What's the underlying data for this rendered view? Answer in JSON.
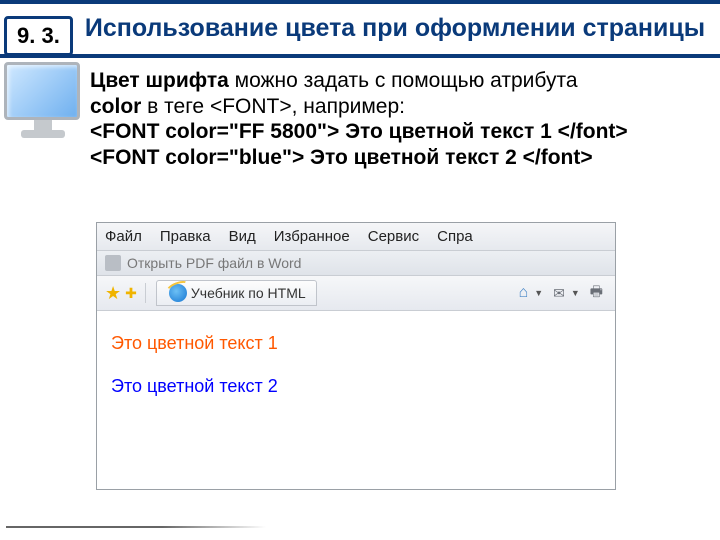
{
  "header": {
    "section_number": "9. 3.",
    "title": "Использование цвета при оформлении страницы"
  },
  "body": {
    "intro_part1": "Цвет шрифта",
    "intro_part2": " можно задать с помощью атрибута ",
    "intro_part3": "color",
    "intro_part4": " в теге <FONT>, например:",
    "code_line1": "<FONT color=\"FF 5800\"> Это цветной текст 1 </font>",
    "code_line2": "<FONT color=\"blue\"> Это цветной текст 2 </font>"
  },
  "browser": {
    "menu": {
      "file": "Файл",
      "edit": "Правка",
      "view": "Вид",
      "favorites": "Избранное",
      "tools": "Сервис",
      "help": "Спра"
    },
    "pdf_bar_text": "Открыть PDF файл в  Word",
    "tab_title": "Учебник по HTML",
    "content": {
      "text1": "Это цветной текст 1",
      "text2": "Это цветной текст 2",
      "color1": "#FF5800",
      "color2": "#0000FF"
    }
  }
}
